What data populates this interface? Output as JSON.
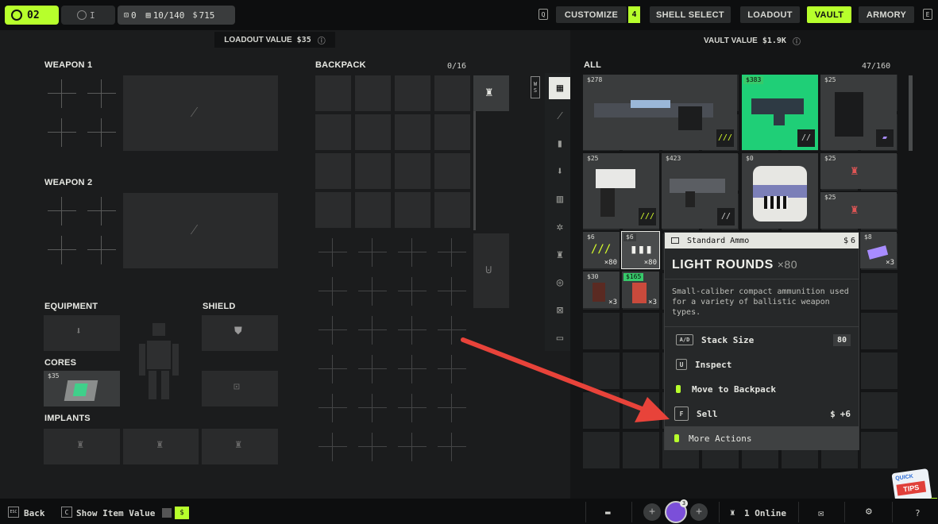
{
  "topbar": {
    "level": "02",
    "stats": {
      "slots": "0",
      "weight": "10/140",
      "currency": "715"
    },
    "nav": [
      {
        "label": "CUSTOMIZE",
        "badge": "4"
      },
      {
        "label": "SHELL SELECT"
      },
      {
        "label": "LOADOUT"
      },
      {
        "label": "VAULT",
        "active": true
      },
      {
        "label": "ARMORY"
      }
    ],
    "left_key": "Q",
    "right_key": "E"
  },
  "loadout": {
    "value_label": "LOADOUT VALUE",
    "value": "35",
    "weapon1": "WEAPON 1",
    "weapon2": "WEAPON 2",
    "equipment": "EQUIPMENT",
    "shield": "SHIELD",
    "cores": "CORES",
    "core_price": "35",
    "implants": "IMPLANTS"
  },
  "backpack": {
    "title": "BACKPACK",
    "capacity": "0/16"
  },
  "vault": {
    "value_label": "VAULT VALUE",
    "value": "1.9K",
    "filter": "ALL",
    "capacity": "47/160",
    "items": [
      {
        "price": "278"
      },
      {
        "price": "383",
        "highlight": true
      },
      {
        "price": "25"
      },
      {
        "price": "25"
      },
      {
        "price": "423"
      },
      {
        "price": "0"
      },
      {
        "price": "25"
      },
      {
        "price": "25"
      },
      {
        "price": "6",
        "count": "×80"
      },
      {
        "price": "6",
        "count": "×80"
      },
      {
        "price": "8",
        "count": "×3"
      },
      {
        "price": "30",
        "count": "×3"
      },
      {
        "price": "165",
        "count": "×3",
        "highlight": true
      }
    ]
  },
  "tooltip": {
    "category": "Standard Ammo",
    "price": "6",
    "title": "LIGHT ROUNDS",
    "qty": "×80",
    "description": "Small-caliber compact ammunition used for a variety of ballistic weapon types.",
    "actions": [
      {
        "key": "A/D",
        "label": "Stack Size",
        "value": "80"
      },
      {
        "key": "U",
        "label": "Inspect"
      },
      {
        "key": "mouse",
        "label": "Move to Backpack"
      },
      {
        "key": "F",
        "label": "Sell",
        "value": "+6"
      },
      {
        "key": "mouse",
        "label": "More Actions"
      }
    ]
  },
  "bottombar": {
    "back": "Back",
    "back_key": "ESC",
    "show_value": "Show Item Value",
    "show_value_key": "C",
    "online": "1 Online",
    "party_count": "3"
  },
  "colors": {
    "accent": "#b7ff2c",
    "arrow": "#e8433a",
    "green_tag": "#37c96a"
  }
}
